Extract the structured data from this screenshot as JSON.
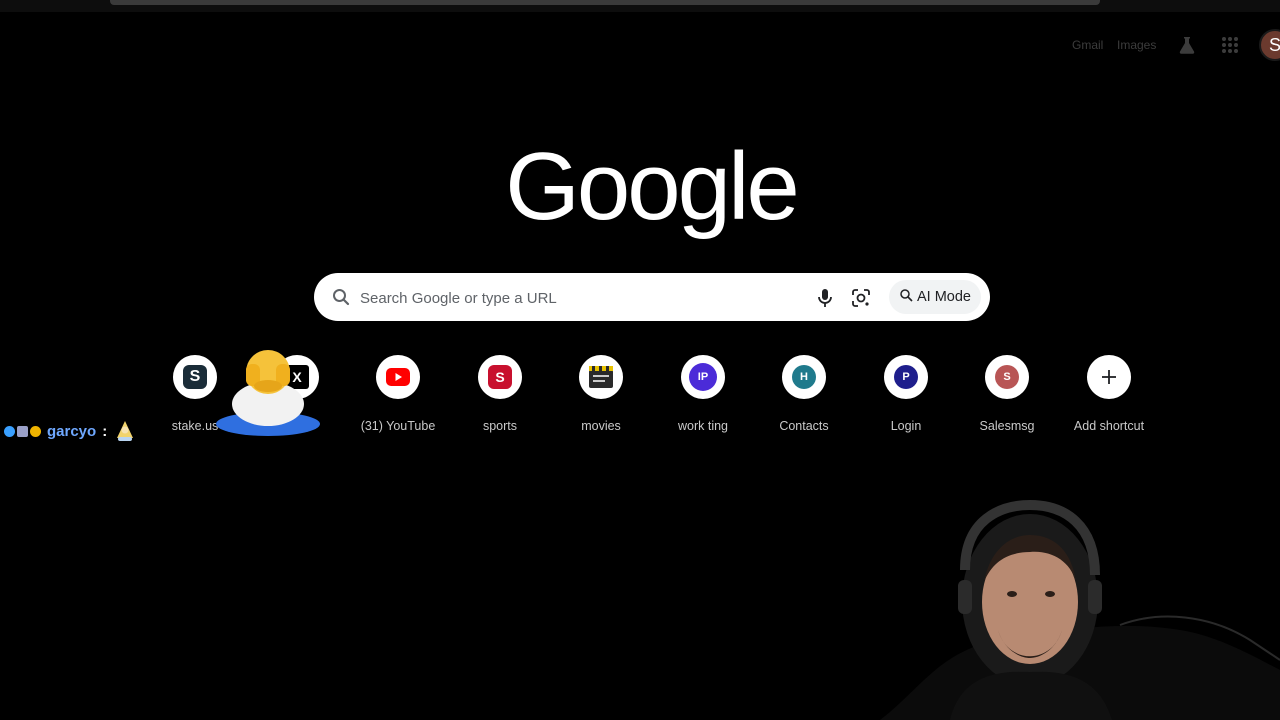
{
  "header": {
    "gmail_label": "Gmail",
    "images_label": "Images",
    "labs_icon": "flask-icon",
    "apps_icon": "apps-grid-icon",
    "avatar_initial": "S"
  },
  "logo": {
    "text": "Google"
  },
  "search": {
    "placeholder": "Search Google or type a URL",
    "value": "",
    "ai_mode_label": "AI Mode"
  },
  "shortcuts": [
    {
      "label": "stake.us",
      "icon": "stake-icon",
      "favicon_text": "S",
      "color": "#1a2c38"
    },
    {
      "label": "X",
      "icon": "x-icon",
      "favicon_text": "X",
      "color": "#000000"
    },
    {
      "label": "(31) YouTube",
      "icon": "youtube-icon",
      "favicon_text": "",
      "color": "#ff0000"
    },
    {
      "label": "sports",
      "icon": "sports-icon",
      "favicon_text": "S",
      "color": "#c8102e"
    },
    {
      "label": "movies",
      "icon": "movies-icon",
      "favicon_text": "",
      "color": "#2a2a2a"
    },
    {
      "label": "work ting",
      "icon": "work-icon",
      "favicon_text": "IP",
      "color": "#4b2bd8"
    },
    {
      "label": "Contacts",
      "icon": "contacts-icon",
      "favicon_text": "H",
      "color": "#1f7a8c"
    },
    {
      "label": "Login",
      "icon": "login-icon",
      "favicon_text": "P",
      "color": "#1e1e8c"
    },
    {
      "label": "Salesmsg",
      "icon": "salesmsg-icon",
      "favicon_text": "S",
      "color": "#b85555"
    },
    {
      "label": "Add shortcut",
      "icon": "plus-icon",
      "favicon_text": "+",
      "color": "#ffffff"
    }
  ],
  "chat_overlay": {
    "username": "garcyo",
    "separator": ":",
    "badge_colors": [
      "#3aa0ff",
      "#9aa0c8",
      "#f0b400"
    ]
  },
  "colors": {
    "background": "#000000",
    "searchbox": "#ffffff",
    "username": "#6fa8ff"
  }
}
